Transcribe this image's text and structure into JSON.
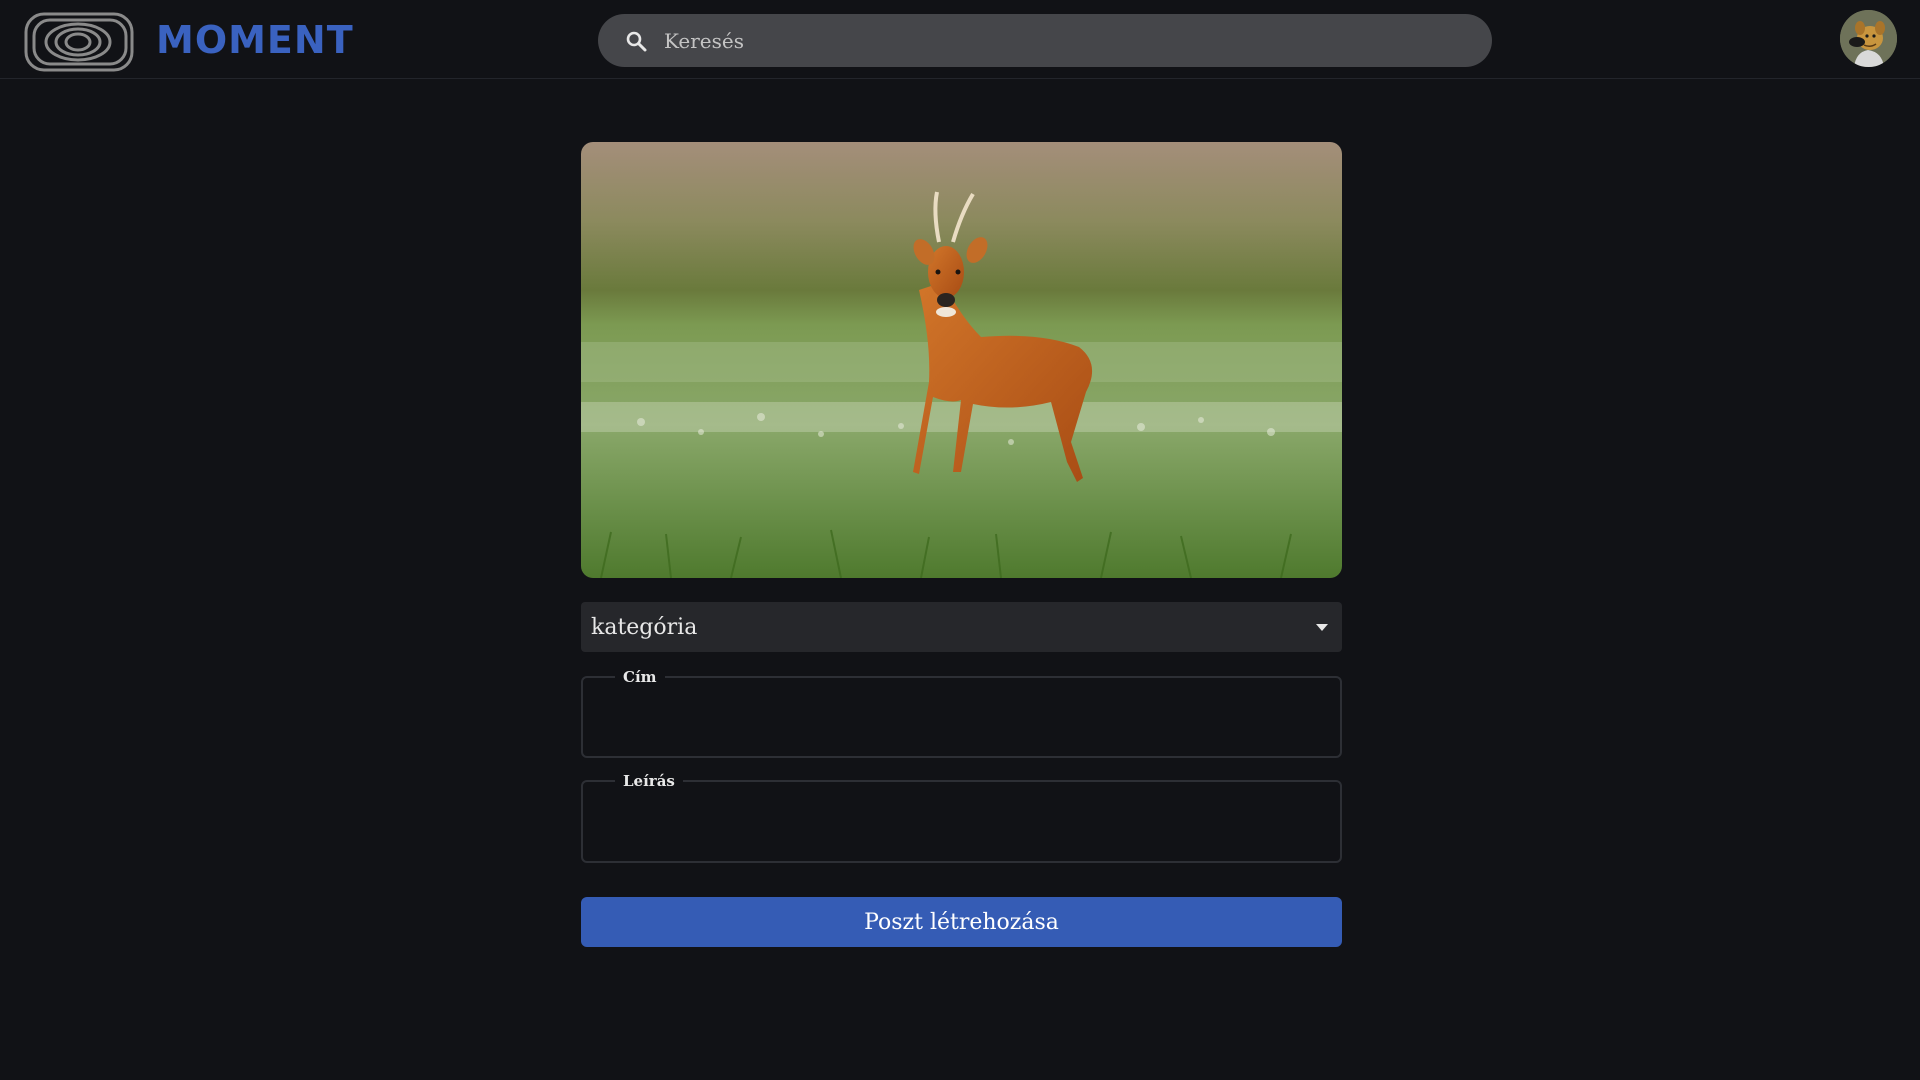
{
  "header": {
    "brand": "MOMENT",
    "search": {
      "placeholder": "Keresés",
      "value": ""
    },
    "avatar_icon": "cartoon-dog-avatar"
  },
  "form": {
    "image_subject": "roe deer in a meadow",
    "category_select": {
      "selected": "kategória",
      "icon": "caret-down-icon"
    },
    "title_field": {
      "label": "Cím",
      "value": ""
    },
    "description_field": {
      "label": "Leírás",
      "value": ""
    },
    "submit_label": "Poszt létrehozása"
  },
  "colors": {
    "background": "#111216",
    "brand": "#3a62c0",
    "search_bg": "#45464a",
    "select_bg": "#26272b",
    "button_bg": "#355cb5"
  }
}
